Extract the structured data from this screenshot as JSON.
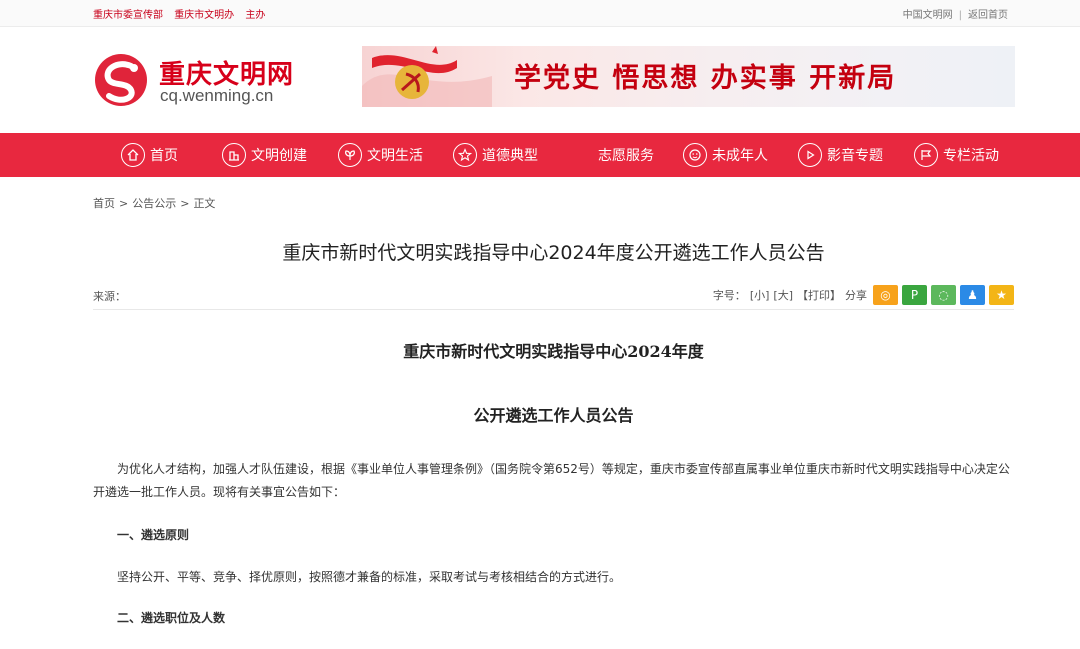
{
  "topbar": {
    "left_links": [
      "重庆市委宣传部",
      "重庆市文明办",
      "主办"
    ],
    "right_links": [
      "中国文明网",
      "返回首页"
    ],
    "separator": "|"
  },
  "logo": {
    "name": "重庆文明网",
    "url": "cq.wenming.cn"
  },
  "banner": {
    "slogan": "学党史 悟思想 办实事 开新局"
  },
  "nav": {
    "items": [
      {
        "label": "首页",
        "icon": "home-icon"
      },
      {
        "label": "文明创建",
        "icon": "building-icon"
      },
      {
        "label": "文明生活",
        "icon": "leaf-icon"
      },
      {
        "label": "道德典型",
        "icon": "star-icon"
      },
      {
        "label": "志愿服务",
        "icon": ""
      },
      {
        "label": "未成年人",
        "icon": "child-icon"
      },
      {
        "label": "影音专题",
        "icon": "play-icon"
      },
      {
        "label": "专栏活动",
        "icon": "flag-icon"
      }
    ]
  },
  "breadcrumb": {
    "home": "首页",
    "section": "公告公示",
    "current": "正文",
    "sep": ">"
  },
  "article": {
    "title": "重庆市新时代文明实践指导中心2024年度公开遴选工作人员公告",
    "source_label": "来源："
  },
  "tools": {
    "font_label": "字号：",
    "small": "[小]",
    "large": "[大]",
    "print": "【打印】",
    "share_label": "分享",
    "share_buttons": [
      {
        "name": "weibo-icon",
        "color": "#f7a21b",
        "glyph": "◎"
      },
      {
        "name": "pinterest-icon",
        "color": "#3aa63f",
        "glyph": "P"
      },
      {
        "name": "wechat-icon",
        "color": "#5cb85c",
        "glyph": "◌"
      },
      {
        "name": "qq-icon",
        "color": "#2b8ae6",
        "glyph": "♟"
      },
      {
        "name": "favorite-icon",
        "color": "#f3b516",
        "glyph": "★"
      }
    ]
  },
  "content": {
    "heading_line1": "重庆市新时代文明实践指导中心2024年度",
    "heading_line2": "公开遴选工作人员公告",
    "intro": "为优化人才结构，加强人才队伍建设，根据《事业单位人事管理条例》（国务院令第652号）等规定，重庆市委宣传部直属事业单位重庆市新时代文明实践指导中心决定公开遴选一批工作人员。现将有关事宜公告如下：",
    "section1_title": "一、遴选原则",
    "section1_text": "坚持公开、平等、竞争、择优原则，按照德才兼备的标准，采取考试与考核相结合的方式进行。",
    "section2_title": "二、遴选职位及人数"
  },
  "colors": {
    "brand_red": "#e8283f",
    "logo_red": "#d7001a"
  }
}
